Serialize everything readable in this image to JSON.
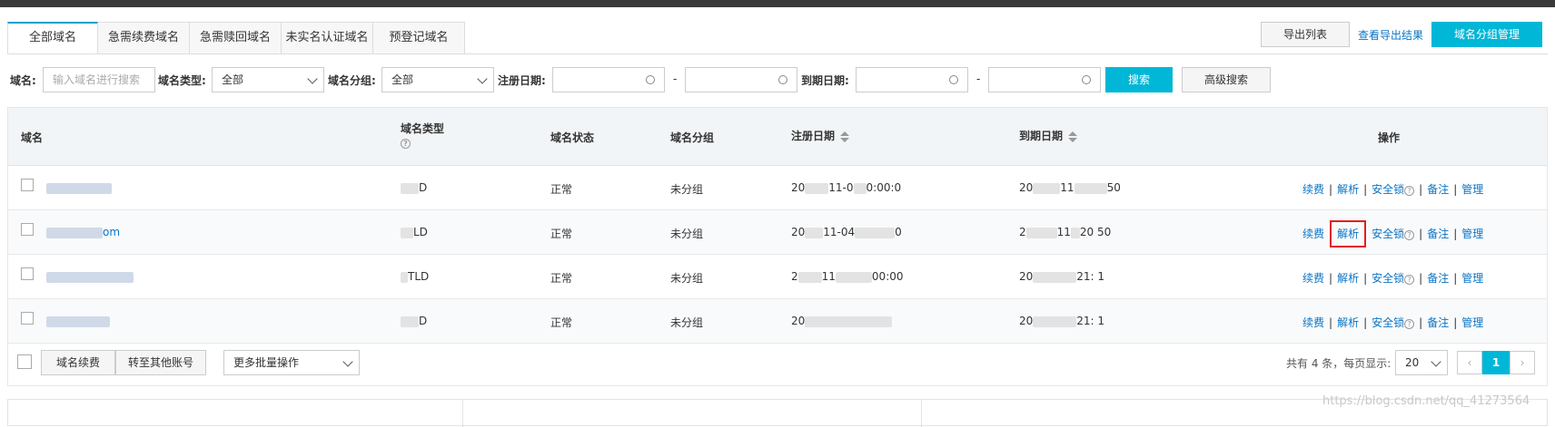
{
  "tabs": [
    "全部域名",
    "急需续费域名",
    "急需赎回域名",
    "未实名认证域名",
    "预登记域名"
  ],
  "toolbar": {
    "export_label": "导出列表",
    "view_export_label": "查看导出结果",
    "group_manage_label": "域名分组管理"
  },
  "filters": {
    "domain_label": "域名:",
    "domain_placeholder": "输入域名进行搜索",
    "type_label": "域名类型:",
    "type_value": "全部",
    "group_label": "域名分组:",
    "group_value": "全部",
    "reg_date_label": "注册日期:",
    "exp_date_label": "到期日期:",
    "range_sep": "-",
    "search_label": "搜索",
    "advanced_label": "高级搜索"
  },
  "table": {
    "headers": {
      "domain": "域名",
      "type": "域名类型",
      "status": "域名状态",
      "group": "域名分组",
      "reg": "注册日期",
      "exp": "到期日期",
      "ops": "操作"
    },
    "rows": [
      {
        "domain_suffix": "",
        "type_suffix": "D",
        "status": "正常",
        "group": "未分组",
        "reg_prefix": "20",
        "reg_mid": "11-0",
        "reg_suffix": "0:00:0",
        "exp_prefix": "20",
        "exp_mid": "11",
        "exp_suffix": "50"
      },
      {
        "domain_suffix": "om",
        "type_suffix": "LD",
        "status": "正常",
        "group": "未分组",
        "reg_prefix": "20",
        "reg_mid": "11-04",
        "reg_suffix": "0",
        "exp_prefix": "2",
        "exp_mid": "11",
        "exp_suffix": "20     50"
      },
      {
        "domain_suffix": "",
        "type_suffix": "TLD",
        "status": "正常",
        "group": "未分组",
        "reg_prefix": "2",
        "reg_mid": "11",
        "reg_suffix": "00:00",
        "exp_prefix": "20",
        "exp_mid": "",
        "exp_suffix": "21:    1"
      },
      {
        "domain_suffix": "",
        "type_suffix": "D",
        "status": "正常",
        "group": "未分组",
        "reg_prefix": "20",
        "reg_mid": "",
        "reg_suffix": "",
        "exp_prefix": "20",
        "exp_mid": "",
        "exp_suffix": "21:    1"
      }
    ],
    "ops": {
      "renew": "续费",
      "resolve": "解析",
      "lock": "安全锁",
      "note": "备注",
      "manage": "管理",
      "sep": "|"
    }
  },
  "footer": {
    "renew_label": "域名续费",
    "transfer_label": "转至其他账号",
    "batch_label": "更多批量操作",
    "total_text": "共有 4 条，每页显示:",
    "page_size": "20",
    "current_page": "1",
    "prev": "‹",
    "next": "›"
  },
  "watermark": "https://blog.csdn.net/qq_41273564",
  "colors": {
    "accent": "#00b7d7",
    "link": "#0a74c5",
    "highlight": "#e0201a"
  }
}
